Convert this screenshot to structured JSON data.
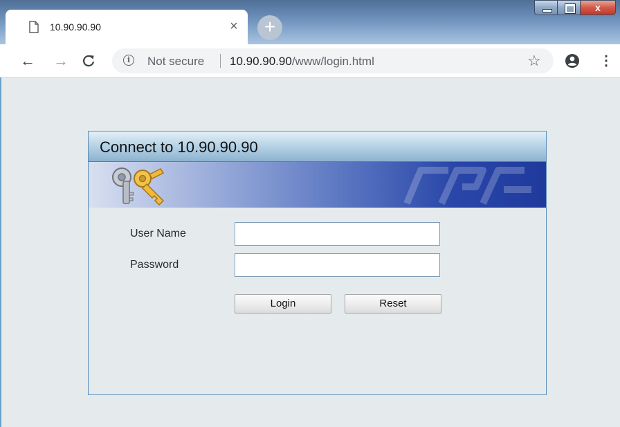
{
  "browser": {
    "tab": {
      "title": "10.90.90.90",
      "close_glyph": "×",
      "page_icon": "page-icon"
    },
    "new_tab_glyph": "+",
    "window_controls": {
      "close_glyph": "x"
    },
    "toolbar": {
      "back_glyph": "←",
      "forward_glyph": "→",
      "reload_glyph": "C",
      "security_label": "Not secure",
      "info_glyph": "i",
      "url_host": "10.90.90.90",
      "url_path": "/www/login.html",
      "bookmark_glyph": "☆",
      "menu_glyph": "⋮"
    }
  },
  "dialog": {
    "title": "Connect to 10.90.90.90",
    "user_name_label": "User Name",
    "password_label": "Password",
    "user_name_value": "",
    "password_value": "",
    "login_label": "Login",
    "reset_label": "Reset"
  },
  "colors": {
    "page_bg": "#e5ebed",
    "dialog_border": "#5b8db8",
    "banner_dark": "#1f3a9c"
  }
}
